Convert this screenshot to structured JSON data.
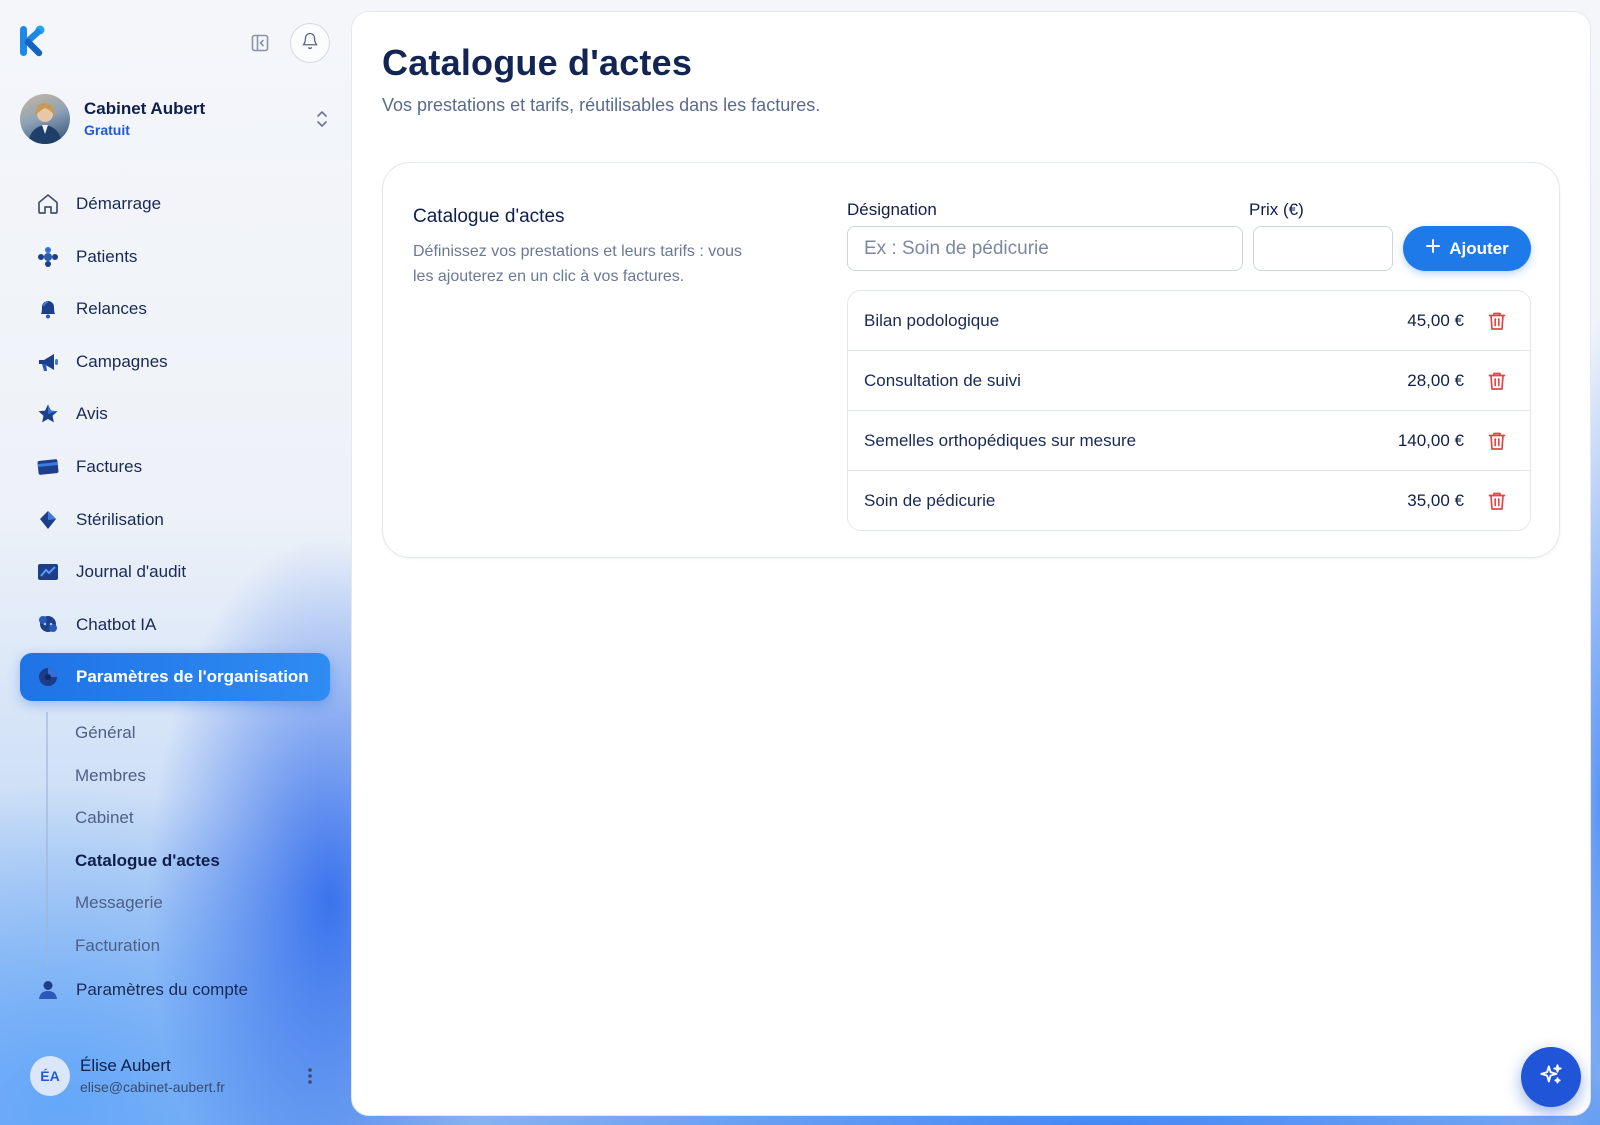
{
  "brand": {
    "logo_icon": "k-logo-icon",
    "accent": "#1e7ae8",
    "active_nav": "#1f73e6",
    "danger": "#e04848"
  },
  "sidebar": {
    "collapse_icon": "sidebar-collapse-icon",
    "bell_icon": "bell-icon",
    "org": {
      "name": "Cabinet Aubert",
      "plan": "Gratuit"
    },
    "items": [
      {
        "label": "Démarrage",
        "icon": "home-icon"
      },
      {
        "label": "Patients",
        "icon": "patients-icon"
      },
      {
        "label": "Relances",
        "icon": "bell-filled-icon"
      },
      {
        "label": "Campagnes",
        "icon": "megaphone-icon"
      },
      {
        "label": "Avis",
        "icon": "star-icon"
      },
      {
        "label": "Factures",
        "icon": "invoice-icon"
      },
      {
        "label": "Stérilisation",
        "icon": "sterilisation-icon"
      },
      {
        "label": "Journal d'audit",
        "icon": "audit-log-icon"
      },
      {
        "label": "Chatbot IA",
        "icon": "chatbot-icon"
      },
      {
        "label": "Paramètres de l'organisation",
        "icon": "org-settings-icon",
        "active": true
      }
    ],
    "subitems": [
      {
        "label": "Général"
      },
      {
        "label": "Membres"
      },
      {
        "label": "Cabinet"
      },
      {
        "label": "Catalogue d'actes",
        "current": true
      },
      {
        "label": "Messagerie"
      },
      {
        "label": "Facturation"
      }
    ],
    "account": {
      "label": "Paramètres du compte",
      "icon": "user-icon"
    },
    "user": {
      "initials": "ÉA",
      "name": "Élise Aubert",
      "email": "elise@cabinet-aubert.fr"
    }
  },
  "main": {
    "title": "Catalogue d'actes",
    "subtitle": "Vos prestations et tarifs, réutilisables dans les factures.",
    "card": {
      "title": "Catalogue d'actes",
      "description": "Définissez vos prestations et leurs tarifs : vous les ajouterez en un clic à vos factures.",
      "designation_label": "Désignation",
      "designation_placeholder": "Ex : Soin de pédicurie",
      "designation_value": "",
      "price_label": "Prix (€)",
      "price_value": "",
      "add_label": "Ajouter",
      "acts": [
        {
          "name": "Bilan podologique",
          "price": "45,00 €"
        },
        {
          "name": "Consultation de suivi",
          "price": "28,00 €"
        },
        {
          "name": "Semelles orthopédiques sur mesure",
          "price": "140,00 €"
        },
        {
          "name": "Soin de pédicurie",
          "price": "35,00 €"
        }
      ]
    }
  },
  "fab_icon": "sparkles-icon"
}
